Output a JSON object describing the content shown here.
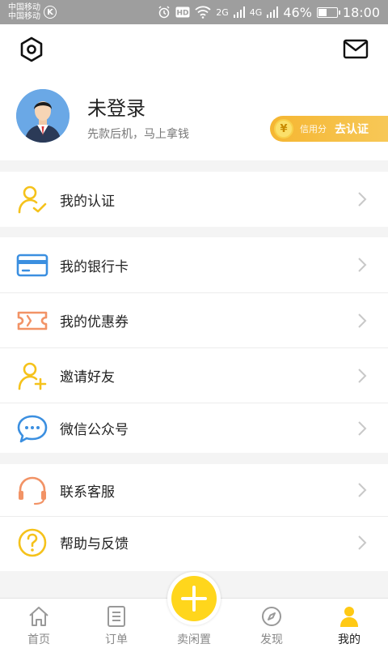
{
  "status_bar": {
    "carrier_1": "中国移动",
    "carrier_2": "中国移动",
    "network_1": "2G",
    "network_2": "4G",
    "battery": "46%",
    "battery_level": 0.46,
    "time": "18:00"
  },
  "header": {
    "username": "未登录",
    "subtitle": "先款后机，马上拿钱",
    "credit_label": "信用分",
    "credit_action": "去认证",
    "yen_symbol": "¥"
  },
  "menu": {
    "group1": [
      {
        "label": "我的认证",
        "icon": "user-check-icon",
        "color": "#f5c21b"
      }
    ],
    "group2": [
      {
        "label": "我的银行卡",
        "icon": "bank-card-icon",
        "color": "#3b8fe0"
      },
      {
        "label": "我的优惠券",
        "icon": "coupon-icon",
        "color": "#f29366"
      },
      {
        "label": "邀请好友",
        "icon": "add-user-icon",
        "color": "#f5c21b"
      },
      {
        "label": "微信公众号",
        "icon": "chat-bubble-icon",
        "color": "#3b8fe0"
      }
    ],
    "group3": [
      {
        "label": "联系客服",
        "icon": "headset-icon",
        "color": "#f29366"
      },
      {
        "label": "帮助与反馈",
        "icon": "help-icon",
        "color": "#f5c21b"
      }
    ]
  },
  "tabbar": {
    "tabs": [
      {
        "label": "首页",
        "icon": "home-icon"
      },
      {
        "label": "订单",
        "icon": "order-list-icon"
      },
      {
        "label": "卖闲置",
        "icon": "plus-icon"
      },
      {
        "label": "发现",
        "icon": "compass-icon"
      },
      {
        "label": "我的",
        "icon": "user-icon"
      }
    ],
    "active": "我的"
  },
  "colors": {
    "accent_yellow": "#ffd61c",
    "badge_orange": "#f5b632",
    "status_bar": "#9e9e9e"
  }
}
